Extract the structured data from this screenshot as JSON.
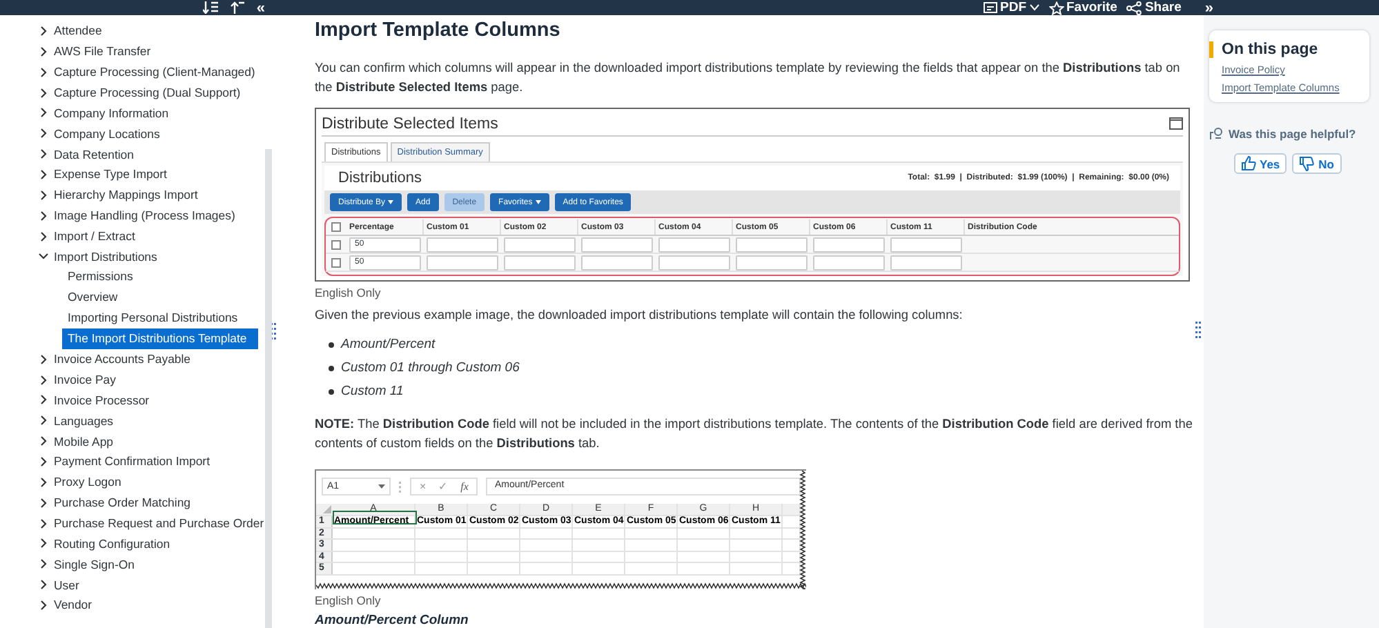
{
  "top_bar": {
    "collapse_glyph": "«",
    "actions": [
      {
        "kind": "pdf",
        "label": "PDF"
      },
      {
        "kind": "favorite",
        "label": "Favorite"
      },
      {
        "kind": "share",
        "label": "Share"
      }
    ],
    "expand_glyph": "»"
  },
  "sidebar": {
    "items": [
      {
        "label": "Attendee",
        "selected": false,
        "expanded": false
      },
      {
        "label": "AWS File Transfer",
        "selected": false,
        "expanded": false
      },
      {
        "label": "Capture Processing (Client-Managed)",
        "selected": false,
        "expanded": false
      },
      {
        "label": "Capture Processing (Dual Support)",
        "selected": false,
        "expanded": false
      },
      {
        "label": "Company Information",
        "selected": false,
        "expanded": false
      },
      {
        "label": "Company Locations",
        "selected": false,
        "expanded": false
      },
      {
        "label": "Data Retention",
        "selected": false,
        "expanded": false
      },
      {
        "label": "Expense Type Import",
        "selected": false,
        "expanded": false
      },
      {
        "label": "Hierarchy Mappings Import",
        "selected": false,
        "expanded": false
      },
      {
        "label": "Image Handling (Process Images)",
        "selected": false,
        "expanded": false
      },
      {
        "label": "Import / Extract",
        "selected": false,
        "expanded": false
      },
      {
        "label": "Import Distributions",
        "selected": false,
        "expanded": true,
        "children": [
          {
            "label": "Permissions",
            "selected": false
          },
          {
            "label": "Overview",
            "selected": false
          },
          {
            "label": "Importing Personal Distributions",
            "selected": false
          },
          {
            "label": "The Import Distributions Template",
            "selected": true
          }
        ]
      },
      {
        "label": "Invoice Accounts Payable",
        "selected": false,
        "expanded": false
      },
      {
        "label": "Invoice Pay",
        "selected": false,
        "expanded": false
      },
      {
        "label": "Invoice Processor",
        "selected": false,
        "expanded": false
      },
      {
        "label": "Languages",
        "selected": false,
        "expanded": false
      },
      {
        "label": "Mobile App",
        "selected": false,
        "expanded": false
      },
      {
        "label": "Payment Confirmation Import",
        "selected": false,
        "expanded": false
      },
      {
        "label": "Proxy Logon",
        "selected": false,
        "expanded": false
      },
      {
        "label": "Purchase Order Matching",
        "selected": false,
        "expanded": false
      },
      {
        "label": "Purchase Request and Purchase Order",
        "selected": false,
        "expanded": false
      },
      {
        "label": "Routing Configuration",
        "selected": false,
        "expanded": false
      },
      {
        "label": "Single Sign-On",
        "selected": false,
        "expanded": false
      },
      {
        "label": "User",
        "selected": false,
        "expanded": false
      },
      {
        "label": "Vendor",
        "selected": false,
        "expanded": false
      }
    ]
  },
  "article": {
    "heading": "Import Template Columns",
    "intro": "You can confirm which columns will appear in the downloaded import distributions template by reviewing the fields that appear on the **Distributions** tab on the **Distribute Selected Items** page.",
    "dialog": {
      "title": "Distribute Selected Items",
      "tabs": [
        {
          "label": "Distributions",
          "selected": true
        },
        {
          "label": "Distribution Summary",
          "selected": false
        }
      ],
      "section_title": "Distributions",
      "totals": "Total:  $1.99  |  Distributed:  $1.99 (100%)  |  Remaining:  $0.00 (0%)",
      "buttons": [
        {
          "label": "Distribute By",
          "dropdown": true,
          "disabled": false
        },
        {
          "label": "Add",
          "dropdown": false,
          "disabled": false
        },
        {
          "label": "Delete",
          "dropdown": false,
          "disabled": true
        },
        {
          "label": "Favorites",
          "dropdown": true,
          "disabled": false
        },
        {
          "label": "Add to Favorites",
          "dropdown": false,
          "disabled": false
        }
      ],
      "table": {
        "all_checked": false,
        "columns": [
          "Percentage",
          "Custom 01",
          "Custom 02",
          "Custom 03",
          "Custom 04",
          "Custom 05",
          "Custom 06",
          "Custom 11",
          "Distribution Code"
        ],
        "rows": [
          {
            "checked": false,
            "percentage": "50"
          },
          {
            "checked": false,
            "percentage": "50"
          }
        ]
      }
    },
    "caption": "English Only",
    "lead": "Given the previous example image, the downloaded import distributions template will contain the following columns:",
    "bullets": [
      "Amount/Percent",
      "Custom 01 through Custom 06",
      "Custom 11"
    ],
    "note": "**NOTE:** The **Distribution Code** field will not be included in the import distributions template. The contents of the **Distribution Code** field are derived from the contents of custom fields on the **Distributions** tab.",
    "spreadsheet": {
      "name_box": "A1",
      "cancel_glyph": "×",
      "enter_glyph": "✓",
      "function_label": "fx",
      "formula": "Amount/Percent",
      "columns": [
        "A",
        "B",
        "C",
        "D",
        "E",
        "F",
        "G",
        "H"
      ],
      "rows": [
        {
          "number": "1",
          "cells": [
            "Amount/Percent",
            "Custom 01",
            "Custom 02",
            "Custom 03",
            "Custom 04",
            "Custom 05",
            "Custom 06",
            "Custom 11"
          ]
        },
        {
          "number": "2",
          "cells": []
        },
        {
          "number": "3",
          "cells": []
        },
        {
          "number": "4",
          "cells": []
        },
        {
          "number": "5",
          "cells": []
        }
      ]
    },
    "caption_2": "English Only",
    "subheading": "Amount/Percent Column"
  },
  "aside": {
    "title": "On this page",
    "links": [
      "Invoice Policy",
      "Import Template Columns"
    ],
    "feedback": {
      "question": "Was this page helpful?",
      "buttons": [
        {
          "kind": "yes",
          "label": "Yes"
        },
        {
          "kind": "no",
          "label": "No"
        }
      ]
    }
  }
}
